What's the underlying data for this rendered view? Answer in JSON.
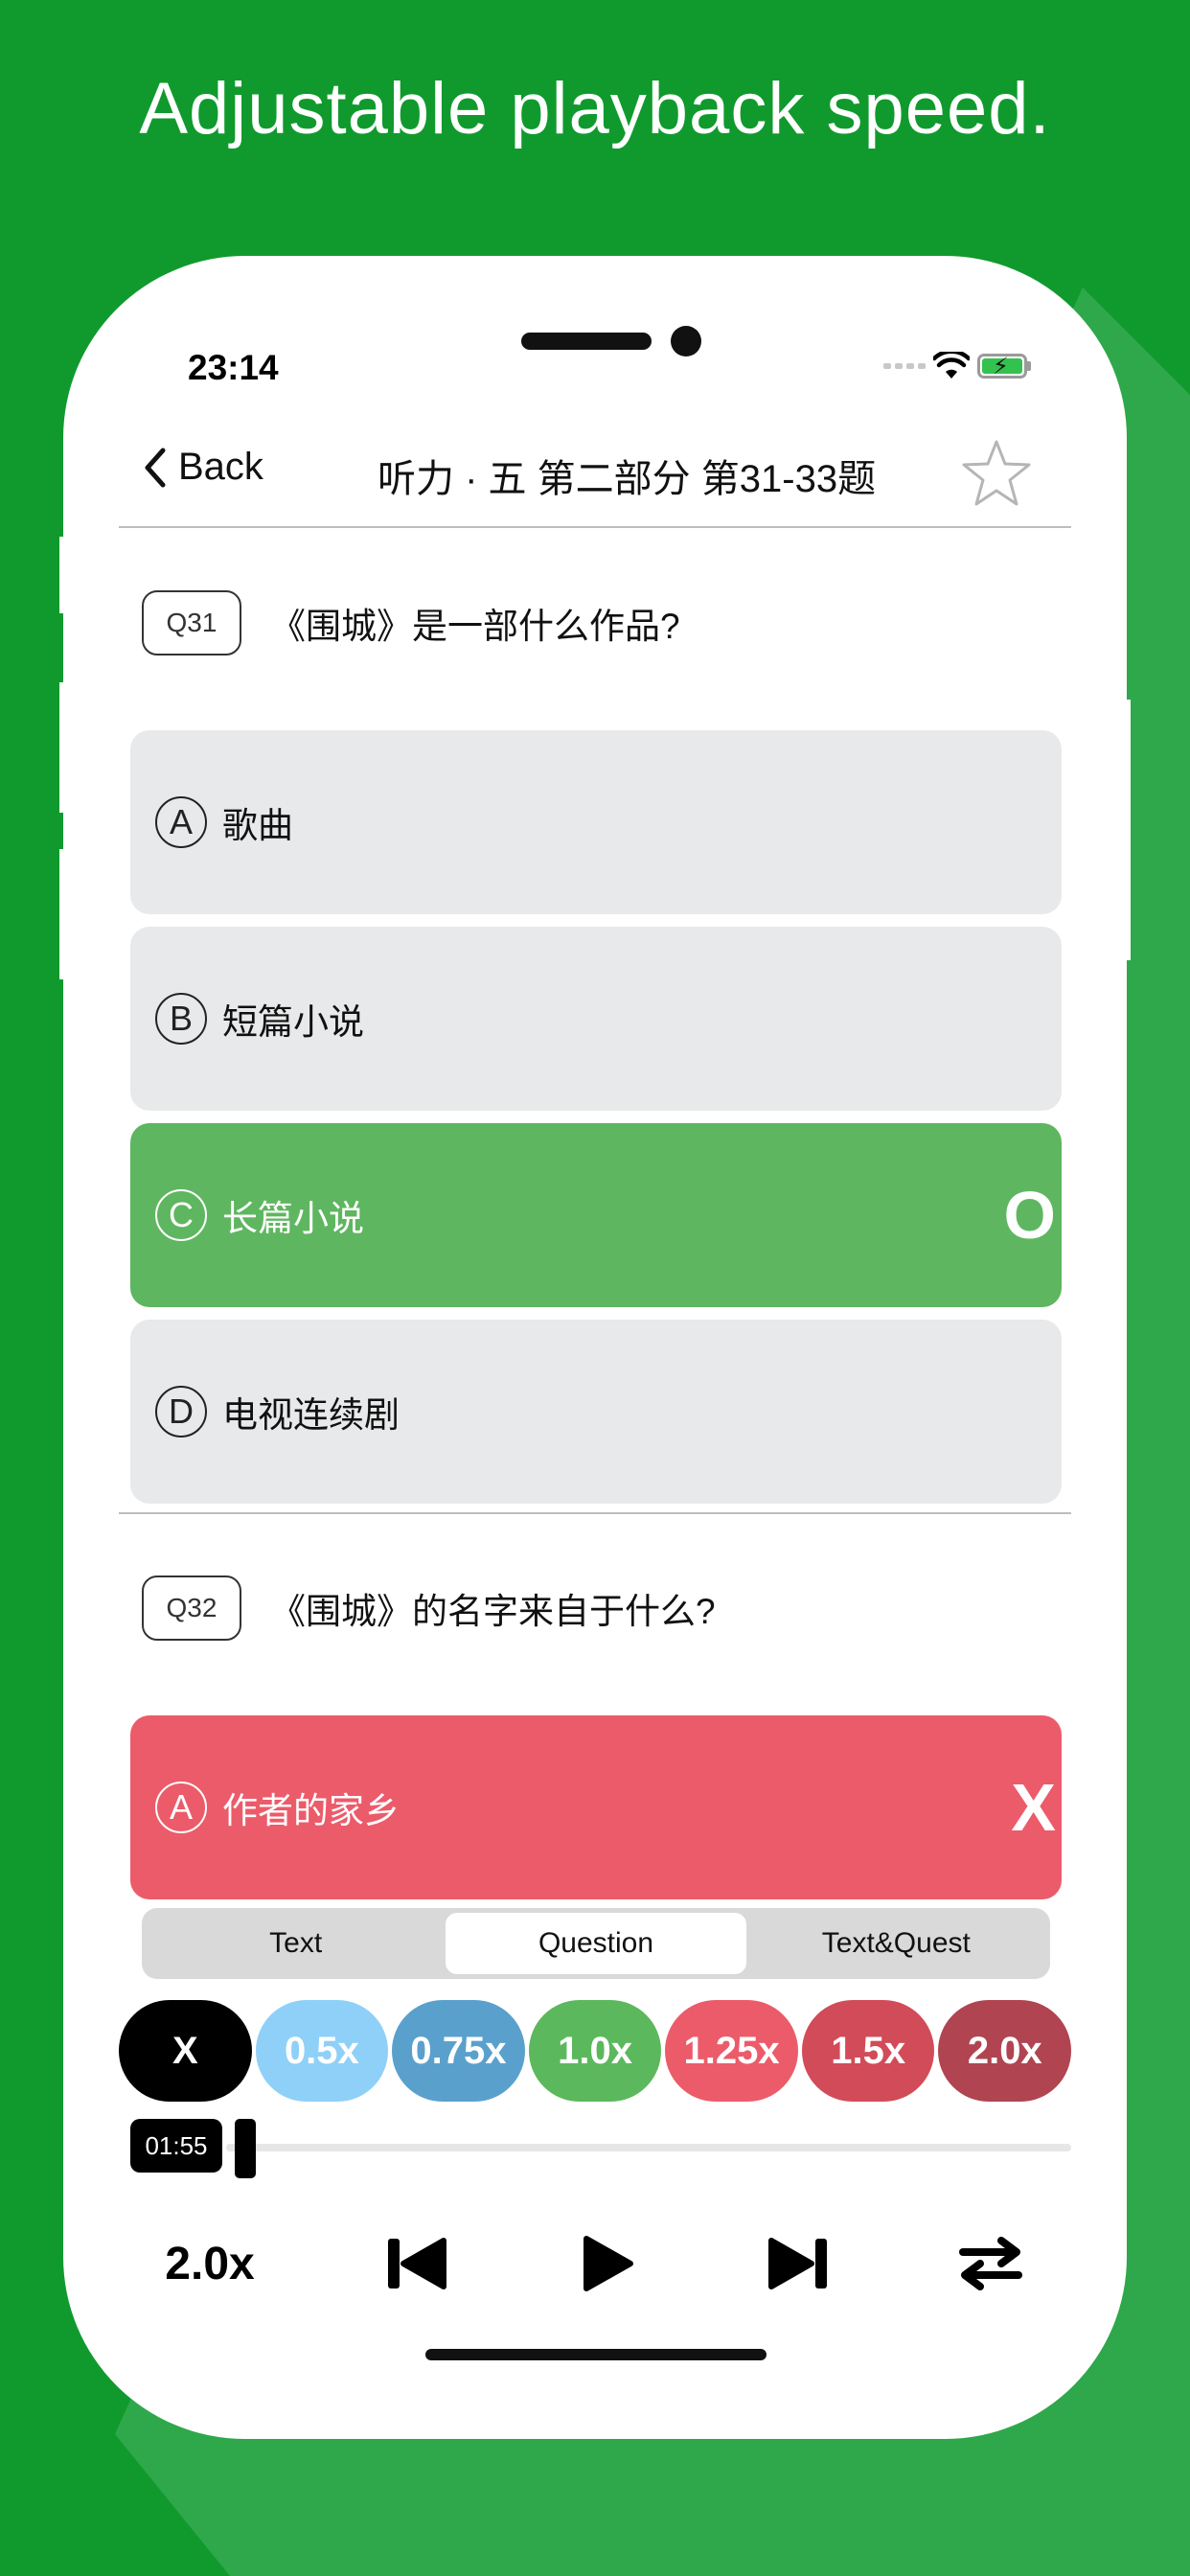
{
  "headline": "Adjustable playback speed.",
  "status_bar": {
    "time": "23:14"
  },
  "nav": {
    "back_label": "Back",
    "title": "听力 · 五 第二部分 第31-33题",
    "favorite_icon": "star-outline-icon"
  },
  "questions": [
    {
      "number": "Q31",
      "text": "《围城》是一部什么作品?",
      "options": [
        {
          "letter": "A",
          "text": "歌曲",
          "state": "neutral",
          "mark": ""
        },
        {
          "letter": "B",
          "text": "短篇小说",
          "state": "neutral",
          "mark": ""
        },
        {
          "letter": "C",
          "text": "长篇小说",
          "state": "correct",
          "mark": "O"
        },
        {
          "letter": "D",
          "text": "电视连续剧",
          "state": "neutral",
          "mark": ""
        }
      ]
    },
    {
      "number": "Q32",
      "text": "《围城》的名字来自于什么?",
      "options": [
        {
          "letter": "A",
          "text": "作者的家乡",
          "state": "wrong",
          "mark": "X"
        }
      ]
    }
  ],
  "mode_tabs": [
    {
      "label": "Text",
      "active": false
    },
    {
      "label": "Question",
      "active": true
    },
    {
      "label": "Text&Quest",
      "active": false
    }
  ],
  "speed_options": [
    {
      "label": "X",
      "color": "#000000"
    },
    {
      "label": "0.5x",
      "color": "#8fd0f8"
    },
    {
      "label": "0.75x",
      "color": "#5aa0cc"
    },
    {
      "label": "1.0x",
      "color": "#5cb85c"
    },
    {
      "label": "1.25x",
      "color": "#ec5b6a"
    },
    {
      "label": "1.5x",
      "color": "#d24b58"
    },
    {
      "label": "2.0x",
      "color": "#b04450"
    }
  ],
  "player": {
    "elapsed": "01:55",
    "progress": 0.01,
    "current_rate": "2.0x"
  },
  "colors": {
    "background": "#109a2d",
    "correct": "#5fb660",
    "wrong": "#ec5b6a",
    "option_neutral": "#e8e9ea"
  }
}
